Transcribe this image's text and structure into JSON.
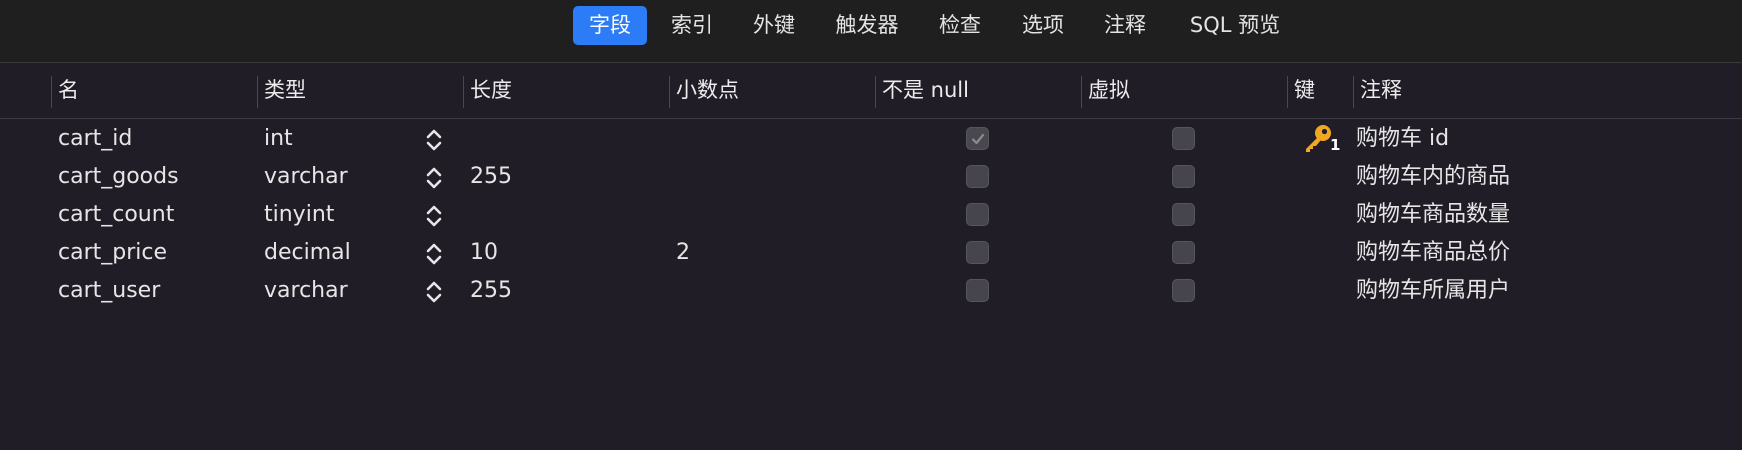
{
  "tabs": [
    {
      "label": "字段",
      "active": true
    },
    {
      "label": "索引",
      "active": false
    },
    {
      "label": "外键",
      "active": false
    },
    {
      "label": "触发器",
      "active": false
    },
    {
      "label": "检查",
      "active": false
    },
    {
      "label": "选项",
      "active": false
    },
    {
      "label": "注释",
      "active": false
    },
    {
      "label": "SQL 预览",
      "active": false
    }
  ],
  "columns": {
    "name": "名",
    "type": "类型",
    "length": "长度",
    "decimals": "小数点",
    "not_null": "不是 null",
    "virtual": "虚拟",
    "key": "键",
    "comment": "注释"
  },
  "rows": [
    {
      "name": "cart_id",
      "type": "int",
      "length": "",
      "decimals": "",
      "not_null": true,
      "not_null_disabled": true,
      "virtual": false,
      "key": "1",
      "comment": "购物车 id"
    },
    {
      "name": "cart_goods",
      "type": "varchar",
      "length": "255",
      "decimals": "",
      "not_null": false,
      "virtual": false,
      "key": "",
      "comment": "购物车内的商品"
    },
    {
      "name": "cart_count",
      "type": "tinyint",
      "length": "",
      "decimals": "",
      "not_null": false,
      "virtual": false,
      "key": "",
      "comment": "购物车商品数量"
    },
    {
      "name": "cart_price",
      "type": "decimal",
      "length": "10",
      "decimals": "2",
      "not_null": false,
      "virtual": false,
      "key": "",
      "comment": "购物车商品总价"
    },
    {
      "name": "cart_user",
      "type": "varchar",
      "length": "255",
      "decimals": "",
      "not_null": false,
      "virtual": false,
      "key": "",
      "comment": "购物车所属用户"
    }
  ],
  "colors": {
    "accent": "#2b7cf6",
    "key_icon": "#f0a722",
    "background": "#201d27",
    "toolbar": "#1f1f1f"
  },
  "icons": {
    "stepper": "up-down-chevron-icon",
    "key": "primary-key-icon",
    "check": "checkmark-icon"
  }
}
